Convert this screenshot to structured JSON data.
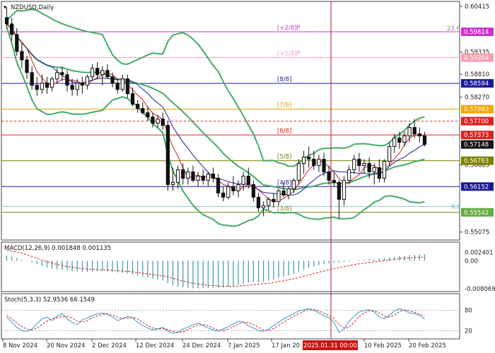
{
  "chart_data": {
    "type": "candlestick",
    "symbol": "NZDUSD,Daily",
    "x_labels": [
      "8 Nov 2024",
      "20 Nov 2024",
      "2 Dec 2024",
      "12 Dec 2024",
      "24 Dec 2024",
      "7 Jan 2025",
      "17 Jan 20",
      "10 Feb 2025",
      "20 Feb 2025"
    ],
    "cursor_label": "2025.01.31 00:00",
    "price_axis": [
      "0.60415",
      "0.59335",
      "0.58810",
      "0.58270",
      "0.56665",
      "0.55075"
    ],
    "price_range": [
      0.5492,
      0.605
    ],
    "price_badges": [
      {
        "text": "0.59814",
        "price": 0.59814,
        "color": "#cc33cc"
      },
      {
        "text": "0.59204",
        "price": 0.59204,
        "color": "#f4a0b0"
      },
      {
        "text": "0.58594",
        "price": 0.58594,
        "color": "#1a1a99"
      },
      {
        "text": "0.57983",
        "price": 0.57983,
        "color": "#f0a800"
      },
      {
        "text": "0.57700",
        "price": 0.577,
        "color": "#dd2222"
      },
      {
        "text": "0.57373",
        "price": 0.57373,
        "color": "#dd2222"
      },
      {
        "text": "0.57148",
        "price": 0.57148,
        "color": "#111111"
      },
      {
        "text": "0.56763",
        "price": 0.56763,
        "color": "#808000"
      },
      {
        "text": "0.56152",
        "price": 0.56152,
        "color": "#1a1a99"
      },
      {
        "text": "0.55542",
        "price": 0.55542,
        "color": "#66aa44"
      }
    ],
    "murrey_levels": [
      {
        "label": "[+2/8]P",
        "price": 0.59814,
        "color": "#cc33cc"
      },
      {
        "label": "[+1/8]P",
        "price": 0.59204,
        "color": "#f4a0b0"
      },
      {
        "label": "[8/8]",
        "price": 0.58594,
        "color": "#1a1a99"
      },
      {
        "label": "[7/8]",
        "price": 0.57983,
        "color": "#e0a000"
      },
      {
        "label": "[6/8]",
        "price": 0.57373,
        "color": "#dd2222"
      },
      {
        "label": "[5/8]",
        "price": 0.56763,
        "color": "#808000"
      },
      {
        "label": "[4/8]",
        "price": 0.56152,
        "color": "#1a1a99"
      },
      {
        "label": "[3/8]",
        "price": 0.55542,
        "color": "#808000"
      }
    ],
    "fib_labels": {
      "top": "23.6",
      "bottom": "0.0"
    },
    "candles": [
      [
        0.6015,
        0.604,
        0.599,
        0.6
      ],
      [
        0.6,
        0.6015,
        0.596,
        0.5975
      ],
      [
        0.5975,
        0.599,
        0.5925,
        0.5935
      ],
      [
        0.5935,
        0.5955,
        0.5895,
        0.5915
      ],
      [
        0.5915,
        0.5925,
        0.587,
        0.5885
      ],
      [
        0.5885,
        0.59,
        0.5845,
        0.5855
      ],
      [
        0.5855,
        0.5875,
        0.583,
        0.5845
      ],
      [
        0.5845,
        0.588,
        0.5835,
        0.586
      ],
      [
        0.586,
        0.5875,
        0.5835,
        0.585
      ],
      [
        0.585,
        0.5875,
        0.584,
        0.587
      ],
      [
        0.587,
        0.5895,
        0.586,
        0.5885
      ],
      [
        0.5885,
        0.59,
        0.5865,
        0.588
      ],
      [
        0.588,
        0.589,
        0.584,
        0.5855
      ],
      [
        0.5855,
        0.587,
        0.583,
        0.5845
      ],
      [
        0.5845,
        0.587,
        0.583,
        0.586
      ],
      [
        0.586,
        0.5875,
        0.5835,
        0.5855
      ],
      [
        0.5855,
        0.588,
        0.5845,
        0.5875
      ],
      [
        0.5875,
        0.5905,
        0.5865,
        0.5895
      ],
      [
        0.5895,
        0.591,
        0.587,
        0.588
      ],
      [
        0.588,
        0.59,
        0.5855,
        0.589
      ],
      [
        0.589,
        0.5905,
        0.587,
        0.5875
      ],
      [
        0.5875,
        0.5885,
        0.585,
        0.586
      ],
      [
        0.586,
        0.587,
        0.5835,
        0.5845
      ],
      [
        0.5845,
        0.588,
        0.584,
        0.587
      ],
      [
        0.587,
        0.588,
        0.5825,
        0.5835
      ],
      [
        0.5835,
        0.585,
        0.5805,
        0.581
      ],
      [
        0.581,
        0.582,
        0.579,
        0.58
      ],
      [
        0.58,
        0.5815,
        0.5785,
        0.579
      ],
      [
        0.579,
        0.5805,
        0.577,
        0.578
      ],
      [
        0.578,
        0.579,
        0.5755,
        0.5765
      ],
      [
        0.5765,
        0.5785,
        0.5755,
        0.5775
      ],
      [
        0.5775,
        0.579,
        0.575,
        0.576
      ],
      [
        0.576,
        0.577,
        0.5605,
        0.562
      ],
      [
        0.562,
        0.566,
        0.5605,
        0.5625
      ],
      [
        0.5625,
        0.5665,
        0.561,
        0.5655
      ],
      [
        0.5655,
        0.567,
        0.562,
        0.5635
      ],
      [
        0.5635,
        0.566,
        0.562,
        0.565
      ],
      [
        0.565,
        0.5665,
        0.5625,
        0.563
      ],
      [
        0.563,
        0.565,
        0.5615,
        0.564
      ],
      [
        0.564,
        0.5655,
        0.562,
        0.563
      ],
      [
        0.563,
        0.565,
        0.5615,
        0.5645
      ],
      [
        0.5645,
        0.566,
        0.5625,
        0.5635
      ],
      [
        0.5635,
        0.5645,
        0.559,
        0.56
      ],
      [
        0.56,
        0.5615,
        0.558,
        0.559
      ],
      [
        0.559,
        0.5625,
        0.5585,
        0.5615
      ],
      [
        0.5615,
        0.564,
        0.5595,
        0.5605
      ],
      [
        0.5605,
        0.563,
        0.559,
        0.562
      ],
      [
        0.562,
        0.565,
        0.5605,
        0.564
      ],
      [
        0.564,
        0.566,
        0.561,
        0.562
      ],
      [
        0.562,
        0.563,
        0.558,
        0.559
      ],
      [
        0.559,
        0.56,
        0.5555,
        0.5565
      ],
      [
        0.5565,
        0.558,
        0.5545,
        0.557
      ],
      [
        0.557,
        0.559,
        0.556,
        0.5585
      ],
      [
        0.5585,
        0.56,
        0.5565,
        0.558
      ],
      [
        0.558,
        0.561,
        0.557,
        0.5605
      ],
      [
        0.5605,
        0.5625,
        0.559,
        0.5595
      ],
      [
        0.5595,
        0.5615,
        0.5585,
        0.561
      ],
      [
        0.561,
        0.5635,
        0.56,
        0.563
      ],
      [
        0.563,
        0.568,
        0.562,
        0.567
      ],
      [
        0.567,
        0.57,
        0.5645,
        0.5685
      ],
      [
        0.5685,
        0.571,
        0.566,
        0.568
      ],
      [
        0.568,
        0.57,
        0.5655,
        0.5665
      ],
      [
        0.5665,
        0.569,
        0.565,
        0.568
      ],
      [
        0.568,
        0.5695,
        0.564,
        0.565
      ],
      [
        0.565,
        0.5665,
        0.562,
        0.563
      ],
      [
        0.563,
        0.565,
        0.5615,
        0.5625
      ],
      [
        0.5625,
        0.563,
        0.554,
        0.5585
      ],
      [
        0.5585,
        0.564,
        0.557,
        0.563
      ],
      [
        0.563,
        0.5665,
        0.562,
        0.5655
      ],
      [
        0.5655,
        0.569,
        0.5645,
        0.568
      ],
      [
        0.568,
        0.5695,
        0.565,
        0.5665
      ],
      [
        0.5665,
        0.568,
        0.5645,
        0.567
      ],
      [
        0.567,
        0.5685,
        0.5635,
        0.565
      ],
      [
        0.565,
        0.567,
        0.562,
        0.566
      ],
      [
        0.566,
        0.568,
        0.5625,
        0.5635
      ],
      [
        0.5635,
        0.568,
        0.5625,
        0.5675
      ],
      [
        0.5675,
        0.572,
        0.5665,
        0.571
      ],
      [
        0.571,
        0.574,
        0.5695,
        0.573
      ],
      [
        0.573,
        0.5745,
        0.5705,
        0.572
      ],
      [
        0.572,
        0.5745,
        0.571,
        0.5735
      ],
      [
        0.5735,
        0.5765,
        0.572,
        0.5755
      ],
      [
        0.5755,
        0.5775,
        0.573,
        0.574
      ],
      [
        0.574,
        0.5755,
        0.572,
        0.5735
      ],
      [
        0.5735,
        0.5745,
        0.571,
        0.5715
      ]
    ],
    "macd": {
      "title": "MACD(12,26,9) 0.001848 0.001135",
      "axis": [
        "0.002401",
        "0.00",
        "-0.008069"
      ],
      "range": [
        -0.0085,
        0.0027
      ],
      "hist": [
        0.0015,
        0.0012,
        0.0008,
        0.0004,
        0.0,
        -0.0005,
        -0.001,
        -0.0015,
        -0.002,
        -0.0023,
        -0.0025,
        -0.0026,
        -0.0028,
        -0.003,
        -0.0031,
        -0.0032,
        -0.0032,
        -0.0031,
        -0.003,
        -0.003,
        -0.0031,
        -0.0032,
        -0.0034,
        -0.0035,
        -0.0037,
        -0.004,
        -0.0043,
        -0.0046,
        -0.0049,
        -0.0052,
        -0.0054,
        -0.0057,
        -0.0065,
        -0.0071,
        -0.0074,
        -0.0077,
        -0.0079,
        -0.008,
        -0.008,
        -0.008,
        -0.0079,
        -0.0078,
        -0.0078,
        -0.0077,
        -0.0075,
        -0.0073,
        -0.007,
        -0.0066,
        -0.0063,
        -0.0062,
        -0.0062,
        -0.0061,
        -0.0058,
        -0.0055,
        -0.005,
        -0.0046,
        -0.0042,
        -0.0038,
        -0.0032,
        -0.0026,
        -0.0021,
        -0.0017,
        -0.0013,
        -0.001,
        -0.0008,
        -0.0006,
        -0.0006,
        -0.0004,
        -0.0002,
        0.0,
        0.0002,
        0.0003,
        0.0004,
        0.0005,
        0.0006,
        0.0007,
        0.0009,
        0.0011,
        0.0013,
        0.0014,
        0.0016,
        0.0017,
        0.0018,
        0.0018
      ],
      "signal": [
        0.003,
        0.0028,
        0.0025,
        0.0021,
        0.0017,
        0.0012,
        0.0007,
        0.0002,
        -0.0003,
        -0.0007,
        -0.0011,
        -0.0014,
        -0.0017,
        -0.0019,
        -0.0021,
        -0.0023,
        -0.0024,
        -0.0025,
        -0.0026,
        -0.0026,
        -0.0027,
        -0.0028,
        -0.0029,
        -0.003,
        -0.0031,
        -0.0032,
        -0.0034,
        -0.0036,
        -0.0038,
        -0.004,
        -0.0042,
        -0.0044,
        -0.0047,
        -0.0051,
        -0.0055,
        -0.0059,
        -0.0062,
        -0.0065,
        -0.0067,
        -0.0069,
        -0.0071,
        -0.0072,
        -0.0073,
        -0.0074,
        -0.0074,
        -0.0074,
        -0.0073,
        -0.0072,
        -0.0071,
        -0.0069,
        -0.0068,
        -0.0066,
        -0.0065,
        -0.0063,
        -0.006,
        -0.0058,
        -0.0055,
        -0.0052,
        -0.0049,
        -0.0045,
        -0.0041,
        -0.0037,
        -0.0033,
        -0.003,
        -0.0026,
        -0.0023,
        -0.002,
        -0.0017,
        -0.0014,
        -0.0011,
        -0.0009,
        -0.0007,
        -0.0005,
        -0.0003,
        -0.0002,
        0.0,
        0.0002,
        0.0004,
        0.0006,
        0.0007,
        0.0008,
        0.0009,
        0.001,
        0.0011
      ]
    },
    "stoch": {
      "title": "Stoch(5,3,3) 52.9536 66.1549",
      "axis": [
        "80",
        "20"
      ],
      "range": [
        0,
        100
      ],
      "k": [
        60,
        45,
        30,
        20,
        18,
        25,
        40,
        55,
        60,
        50,
        62,
        70,
        55,
        45,
        38,
        52,
        58,
        65,
        70,
        72,
        68,
        60,
        50,
        55,
        62,
        58,
        45,
        35,
        28,
        22,
        25,
        30,
        18,
        12,
        15,
        25,
        30,
        38,
        42,
        35,
        28,
        22,
        18,
        25,
        32,
        40,
        48,
        45,
        35,
        28,
        20,
        18,
        25,
        35,
        45,
        55,
        62,
        70,
        78,
        82,
        85,
        80,
        72,
        65,
        58,
        45,
        15,
        25,
        48,
        62,
        75,
        80,
        82,
        75,
        60,
        55,
        65,
        78,
        85,
        80,
        72,
        70,
        65,
        55
      ],
      "d": [
        65,
        55,
        42,
        32,
        25,
        22,
        28,
        38,
        48,
        55,
        58,
        62,
        62,
        57,
        48,
        46,
        50,
        58,
        64,
        68,
        70,
        66,
        60,
        56,
        57,
        59,
        55,
        45,
        35,
        28,
        25,
        26,
        24,
        18,
        15,
        17,
        23,
        31,
        37,
        38,
        35,
        28,
        22,
        20,
        25,
        32,
        40,
        45,
        44,
        38,
        30,
        22,
        21,
        26,
        35,
        45,
        54,
        62,
        70,
        77,
        82,
        82,
        78,
        72,
        65,
        56,
        38,
        28,
        30,
        45,
        62,
        72,
        79,
        79,
        72,
        63,
        60,
        66,
        76,
        81,
        79,
        74,
        69,
        63
      ]
    }
  }
}
